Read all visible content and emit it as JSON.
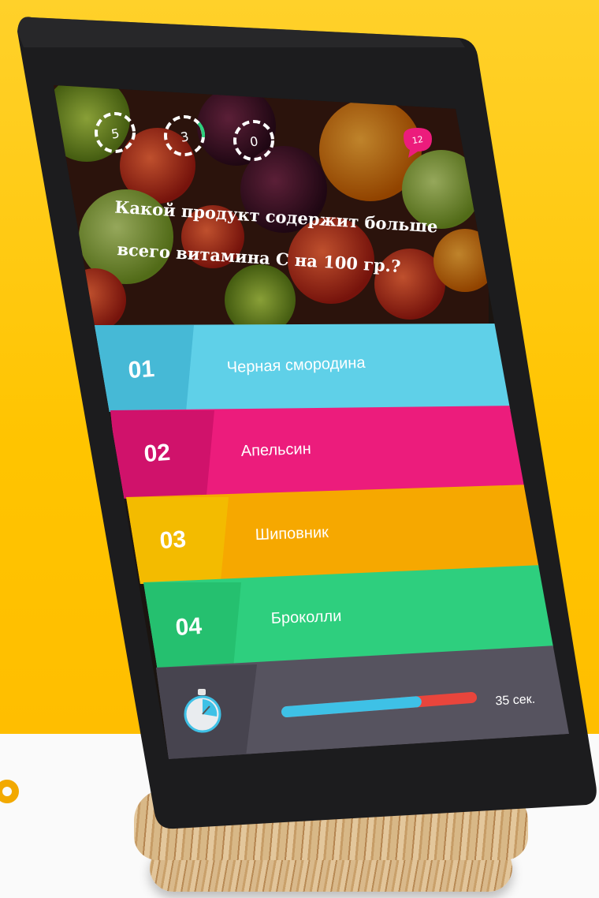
{
  "quiz": {
    "counters": [
      {
        "value": "5"
      },
      {
        "value": "3"
      },
      {
        "value": "0"
      }
    ],
    "badge": "12",
    "question_line1": "Какой продукт содержит больше",
    "question_line2": "всего витамина С на 100 гр.?",
    "answers": [
      {
        "number": "01",
        "label": "Черная смородина",
        "color": "#5fd0e8",
        "dark": "#46b9d6"
      },
      {
        "number": "02",
        "label": "Апельсин",
        "color": "#ec1c7c",
        "dark": "#d0126b"
      },
      {
        "number": "03",
        "label": "Шиповник",
        "color": "#f6a800",
        "dark": "#f3bb00"
      },
      {
        "number": "04",
        "label": "Броколли",
        "color": "#2ecf7e",
        "dark": "#25c06f"
      }
    ],
    "timer": {
      "label": "35 сек.",
      "progress": 0.7,
      "fill_color": "#3ec1e6",
      "remaining_color": "#e8453c"
    }
  },
  "colors": {
    "background": "#ffc400",
    "bezel": "#1c1c1e",
    "footer": "#56535f",
    "badge": "#ec1c7c"
  }
}
